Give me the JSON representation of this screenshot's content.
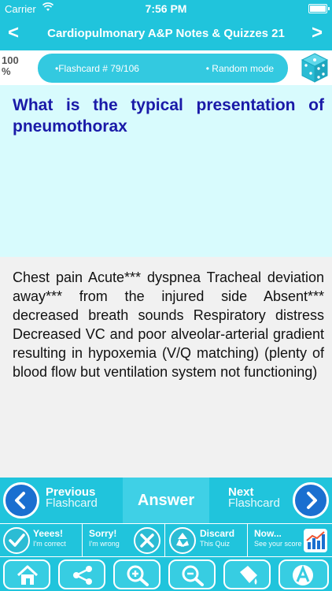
{
  "status": {
    "carrier": "Carrier",
    "time": "7:56 PM"
  },
  "nav": {
    "back": "<",
    "title": "Cardiopulmonary A&P Notes & Quizzes 21",
    "forward": ">"
  },
  "progress": {
    "percent": "100 %",
    "flashcard": "•Flashcard # 79/106",
    "mode": "• Random mode"
  },
  "question": "What is the typical presentation of pneumothorax",
  "answer": "Chest pain Acute*** dyspnea Tracheal deviation away*** from the injured side Absent*** decreased breath sounds Respiratory distress Decreased VC and poor alveolar-arterial gradient resulting in hypoxemia (V/Q matching) (plenty of blood flow but ventilation system not functioning)",
  "actions": {
    "previous": "Previous",
    "previous_sub": "Flashcard",
    "answer": "Answer",
    "next": "Next",
    "next_sub": "Flashcard"
  },
  "score": [
    {
      "title": "Yeees!",
      "sub": "I'm correct",
      "icon": "check-icon"
    },
    {
      "title": "Sorry!",
      "sub": "I'm wrong",
      "icon": "x-icon"
    },
    {
      "title": "Discard",
      "sub": "This Quiz",
      "icon": "recycle-icon"
    },
    {
      "title": "Now...",
      "sub": "See your score",
      "icon": "chart-icon"
    }
  ],
  "toolbar": [
    "home-icon",
    "share-icon",
    "zoom-in-icon",
    "zoom-out-icon",
    "paint-icon",
    "font-icon"
  ],
  "colors": {
    "accent": "#20c4dc",
    "question_bg": "#d8fbfd",
    "question_text": "#1a1aa8",
    "answer_bg": "#f1f1f1"
  }
}
